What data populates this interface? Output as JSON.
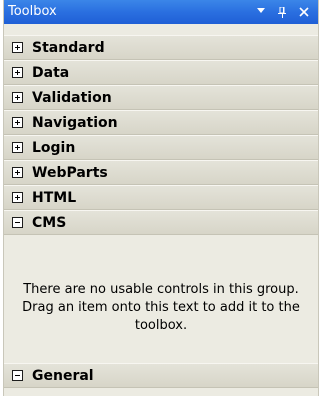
{
  "window": {
    "title": "Toolbox",
    "buttons": {
      "dropdown_icon": "chevron-down-icon",
      "pin_icon": "pin-icon",
      "close_icon": "close-icon"
    }
  },
  "groups": [
    {
      "label": "Standard",
      "expanded": false
    },
    {
      "label": "Data",
      "expanded": false
    },
    {
      "label": "Validation",
      "expanded": false
    },
    {
      "label": "Navigation",
      "expanded": false
    },
    {
      "label": "Login",
      "expanded": false
    },
    {
      "label": "WebParts",
      "expanded": false
    },
    {
      "label": "HTML",
      "expanded": false
    },
    {
      "label": "CMS",
      "expanded": true
    },
    {
      "label": "General",
      "expanded": true
    }
  ],
  "cms_empty_message": "There are no usable controls in this group. Drag an item onto this text to add it to the toolbox.",
  "colors": {
    "titlebar": "#2a6fe0",
    "panel": "#ecebe2",
    "group_header": "#d7d5c8"
  }
}
